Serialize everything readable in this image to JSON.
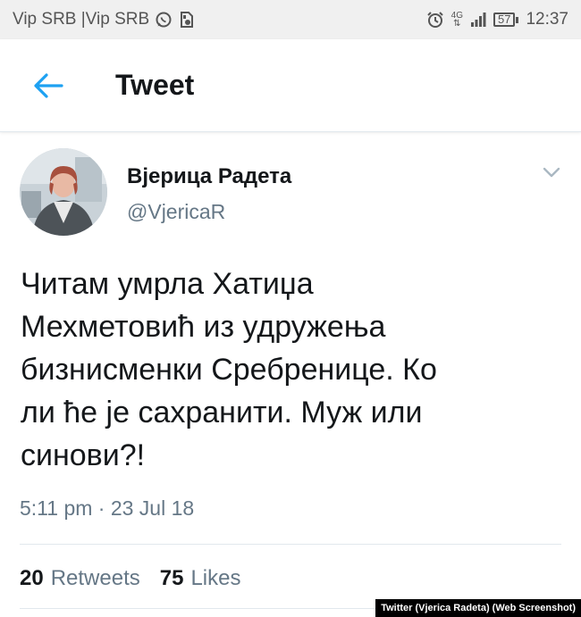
{
  "status_bar": {
    "carrier": "Vip SRB |Vip SRB",
    "network_label_top": "4G",
    "network_label_bottom": "⇅",
    "battery": "57",
    "time": "12:37",
    "icons": [
      "whatsapp-icon",
      "sim-settings-icon",
      "alarm-icon",
      "signal-icon",
      "battery-icon"
    ]
  },
  "header": {
    "title": "Tweet",
    "accent_color": "#1da1f2"
  },
  "tweet": {
    "author_name": "Вјерица Радета",
    "author_handle": "@VjericaR",
    "text_lines": [
      "Читам умрла Хатиџа",
      "Мехметовић из удружења",
      "бизнисменки Сребренице. Ко",
      "ли ће је сахранити. Муж или",
      "синови?!"
    ],
    "timestamp": "5:11 pm · 23 Jul 18",
    "retweets_count": "20",
    "retweets_label": "Retweets",
    "likes_count": "75",
    "likes_label": "Likes"
  },
  "credit": "Twitter (Vjerica Radeta) (Web Screenshot)"
}
